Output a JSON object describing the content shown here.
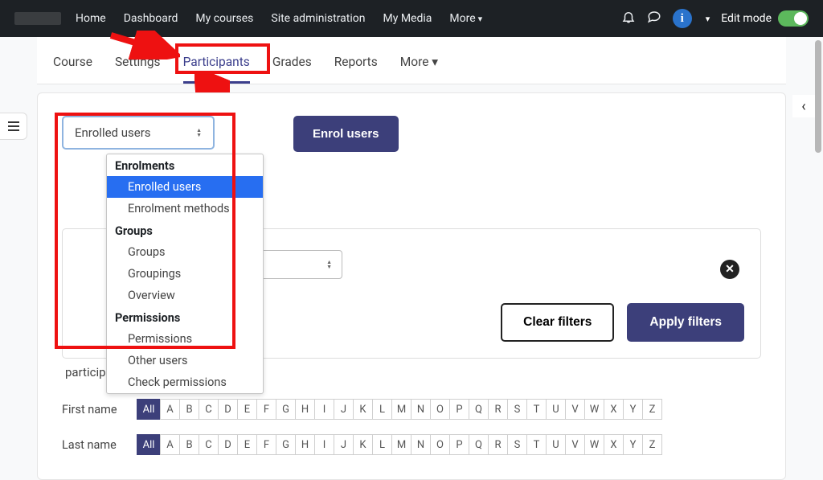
{
  "top_nav": {
    "items": [
      "Home",
      "Dashboard",
      "My courses",
      "Site administration",
      "My Media",
      "More"
    ],
    "edit_mode_label": "Edit mode"
  },
  "sub_nav": {
    "items": [
      "Course",
      "Settings",
      "Participants",
      "Grades",
      "Reports",
      "More"
    ],
    "active": "Participants"
  },
  "dropdown_select": {
    "value": "Enrolled users"
  },
  "enrol_button": "Enrol users",
  "dropdown_menu": {
    "groups": [
      {
        "label": "Enrolments",
        "items": [
          "Enrolled users",
          "Enrolment methods"
        ]
      },
      {
        "label": "Groups",
        "items": [
          "Groups",
          "Groupings",
          "Overview"
        ]
      },
      {
        "label": "Permissions",
        "items": [
          "Permissions",
          "Other users",
          "Check permissions"
        ]
      }
    ],
    "selected": "Enrolled users"
  },
  "filters": {
    "clear": "Clear filters",
    "apply": "Apply filters"
  },
  "participants_found": "participants found",
  "alpha": {
    "first_label": "First name",
    "last_label": "Last name",
    "all": "All",
    "letters": [
      "A",
      "B",
      "C",
      "D",
      "E",
      "F",
      "G",
      "H",
      "I",
      "J",
      "K",
      "L",
      "M",
      "N",
      "O",
      "P",
      "Q",
      "R",
      "S",
      "T",
      "U",
      "V",
      "W",
      "X",
      "Y",
      "Z"
    ]
  },
  "colors": {
    "primary": "#3c3f7a",
    "highlight": "#276ef1",
    "annotation": "#e11"
  }
}
